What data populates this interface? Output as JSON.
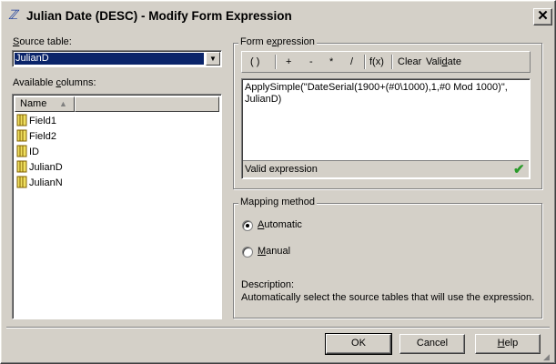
{
  "window": {
    "title": "Julian Date (DESC) - Modify Form Expression",
    "close_glyph": "✕",
    "icon": "expression-icon"
  },
  "source": {
    "label_prefix": "S",
    "label_rest": "ource table:",
    "selected": "JulianD"
  },
  "columns": {
    "label_prefix": "Available ",
    "label_u": "c",
    "label_rest": "olumns:",
    "header": "Name",
    "items": [
      "Field1",
      "Field2",
      "ID",
      "JulianD",
      "JulianN"
    ]
  },
  "expression": {
    "group_title_pre": "Form e",
    "group_title_u": "x",
    "group_title_post": "pression",
    "toolbar": {
      "parens": "( )",
      "plus": "+",
      "minus": "-",
      "multiply": "*",
      "divide": "/",
      "function": "f(x)",
      "clear": "Clear",
      "validate_pre": "Vali",
      "validate_u": "d",
      "validate_post": "ate"
    },
    "text": "ApplySimple(\"DateSerial(1900+(#0\\1000),1,#0 Mod 1000)\", JulianD)",
    "status": "Valid expression",
    "status_color": "#2a9a2a"
  },
  "mapping": {
    "group_title": "Mapping method",
    "automatic_u": "A",
    "automatic_rest": "utomatic",
    "manual_u": "M",
    "manual_rest": "anual",
    "selected": "automatic",
    "description_label": "Description:",
    "description_text": "Automatically select the source tables that will use the expression."
  },
  "buttons": {
    "ok": "OK",
    "cancel": "Cancel",
    "help_u": "H",
    "help_rest": "elp"
  }
}
